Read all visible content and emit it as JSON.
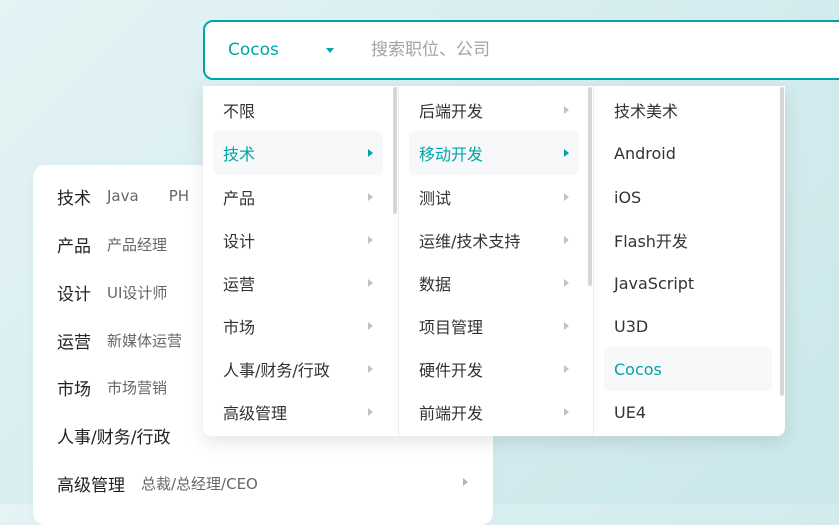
{
  "search": {
    "type_label": "Cocos",
    "placeholder": "搜索职位、公司"
  },
  "background_categories": [
    {
      "name": "技术",
      "subs": [
        "Java",
        "PH"
      ]
    },
    {
      "name": "产品",
      "subs": [
        "产品经理"
      ]
    },
    {
      "name": "设计",
      "subs": [
        "UI设计师"
      ]
    },
    {
      "name": "运营",
      "subs": [
        "新媒体运营"
      ]
    },
    {
      "name": "市场",
      "subs": [
        "市场营销"
      ]
    },
    {
      "name": "人事/财务/行政",
      "subs": []
    },
    {
      "name": "高级管理",
      "subs": [
        "总裁/总经理/CEO"
      ]
    }
  ],
  "dropdown": {
    "level1": [
      "不限",
      "技术",
      "产品",
      "设计",
      "运营",
      "市场",
      "人事/财务/行政",
      "高级管理"
    ],
    "level1_active": "技术",
    "level2": [
      "后端开发",
      "移动开发",
      "测试",
      "运维/技术支持",
      "数据",
      "项目管理",
      "硬件开发",
      "前端开发"
    ],
    "level2_active": "移动开发",
    "level3": [
      "技术美术",
      "Android",
      "iOS",
      "Flash开发",
      "JavaScript",
      "U3D",
      "Cocos",
      "UE4"
    ],
    "level3_active": "Cocos"
  },
  "colors": {
    "accent": "#00a6a7",
    "active_bg": "#f7f8fa"
  }
}
